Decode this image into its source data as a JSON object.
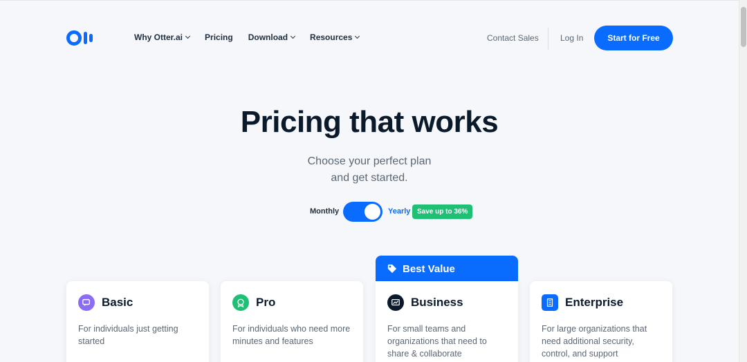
{
  "header": {
    "nav": [
      {
        "label": "Why Otter.ai",
        "dropdown": true
      },
      {
        "label": "Pricing",
        "dropdown": false
      },
      {
        "label": "Download",
        "dropdown": true
      },
      {
        "label": "Resources",
        "dropdown": true
      }
    ],
    "contact_sales": "Contact Sales",
    "login": "Log In",
    "cta": "Start for Free"
  },
  "hero": {
    "title": "Pricing that works",
    "subtitle_line1": "Choose your perfect plan",
    "subtitle_line2": "and get started."
  },
  "billing": {
    "monthly_label": "Monthly",
    "yearly_label": "Yearly",
    "selected": "Yearly",
    "save_badge": "Save up to 36%"
  },
  "plans": [
    {
      "name": "Basic",
      "description": "For individuals just getting started",
      "icon": "chat-icon",
      "icon_color": "#8b6cf2"
    },
    {
      "name": "Pro",
      "description": "For individuals who need more minutes and features",
      "icon": "badge-icon",
      "icon_color": "#1fbf75"
    },
    {
      "name": "Business",
      "description": "For small teams and organizations that need to share & collaborate",
      "icon": "chart-icon",
      "icon_color": "#0b1a2b",
      "ribbon": "Best Value"
    },
    {
      "name": "Enterprise",
      "description": "For large organizations that need additional security, control, and support",
      "icon": "building-icon",
      "icon_color": "#0a6cff"
    }
  ],
  "colors": {
    "brand": "#0a6cff",
    "success": "#1fbf75",
    "text_dark": "#0b1a2b",
    "text_muted": "#5b6775",
    "background": "#f5f7fa"
  }
}
